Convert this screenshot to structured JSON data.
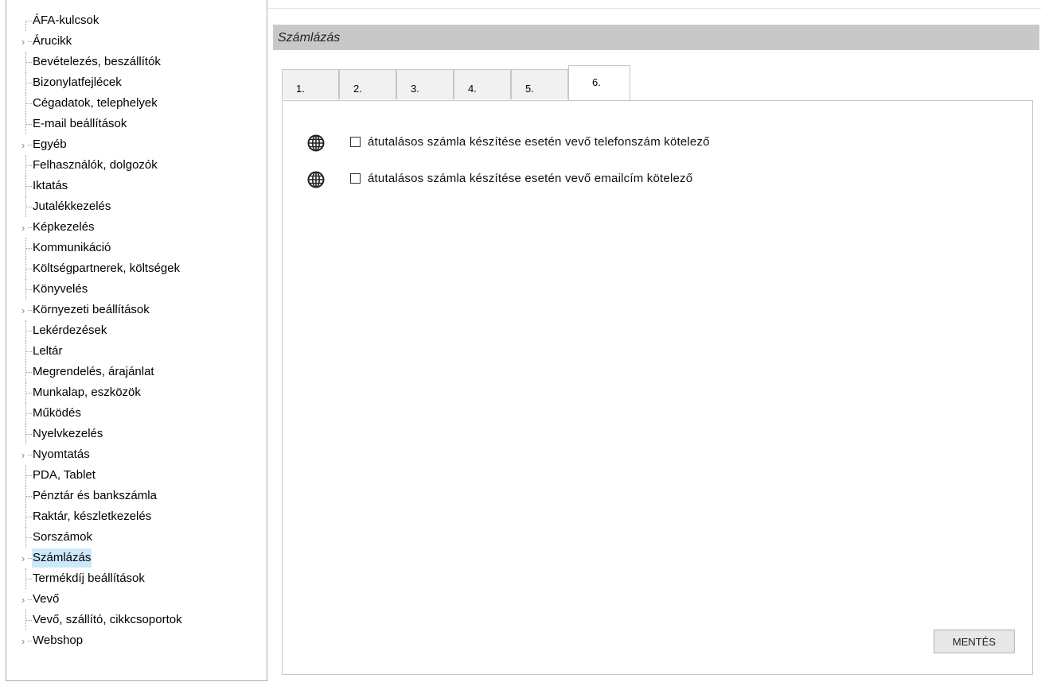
{
  "sidebar": {
    "items": [
      {
        "label": "ÁFA-kulcsok",
        "expandable": false
      },
      {
        "label": "Árucikk",
        "expandable": true
      },
      {
        "label": "Bevételezés, beszállítók",
        "expandable": false
      },
      {
        "label": "Bizonylatfejlécek",
        "expandable": false
      },
      {
        "label": "Cégadatok, telephelyek",
        "expandable": false
      },
      {
        "label": "E-mail beállítások",
        "expandable": false
      },
      {
        "label": "Egyéb",
        "expandable": true
      },
      {
        "label": "Felhasználók, dolgozók",
        "expandable": false
      },
      {
        "label": "Iktatás",
        "expandable": false
      },
      {
        "label": "Jutalékkezelés",
        "expandable": false
      },
      {
        "label": "Képkezelés",
        "expandable": true
      },
      {
        "label": "Kommunikáció",
        "expandable": false
      },
      {
        "label": "Költségpartnerek, költségek",
        "expandable": false
      },
      {
        "label": "Könyvelés",
        "expandable": false
      },
      {
        "label": "Környezeti beállítások",
        "expandable": true
      },
      {
        "label": "Lekérdezések",
        "expandable": false
      },
      {
        "label": "Leltár",
        "expandable": false
      },
      {
        "label": "Megrendelés, árajánlat",
        "expandable": false
      },
      {
        "label": "Munkalap, eszközök",
        "expandable": false
      },
      {
        "label": "Működés",
        "expandable": false
      },
      {
        "label": "Nyelvkezelés",
        "expandable": false
      },
      {
        "label": "Nyomtatás",
        "expandable": true
      },
      {
        "label": "PDA, Tablet",
        "expandable": false
      },
      {
        "label": "Pénztár és bankszámla",
        "expandable": false
      },
      {
        "label": "Raktár, készletkezelés",
        "expandable": false
      },
      {
        "label": "Sorszámok",
        "expandable": false
      },
      {
        "label": "Számlázás",
        "expandable": true,
        "selected": true
      },
      {
        "label": "Termékdíj beállítások",
        "expandable": false
      },
      {
        "label": "Vevő",
        "expandable": true
      },
      {
        "label": "Vevő, szállító, cikkcsoportok",
        "expandable": false
      },
      {
        "label": "Webshop",
        "expandable": true
      }
    ]
  },
  "header": {
    "title": "Számlázás"
  },
  "tabs": [
    {
      "label": "1."
    },
    {
      "label": "2."
    },
    {
      "label": "3."
    },
    {
      "label": "4."
    },
    {
      "label": "5."
    },
    {
      "label": "6.",
      "active": true
    }
  ],
  "options": [
    {
      "icon": "globe-icon",
      "label": "átutalásos számla készítése esetén vevő telefonszám kötelező",
      "checked": false
    },
    {
      "icon": "globe-icon",
      "label": "átutalásos számla készítése esetén vevő emailcím kötelező",
      "checked": false
    }
  ],
  "actions": {
    "save_label": "MENTÉS"
  },
  "colors": {
    "selected_item": "#cce8fb",
    "header_band": "#c8c8c8"
  }
}
